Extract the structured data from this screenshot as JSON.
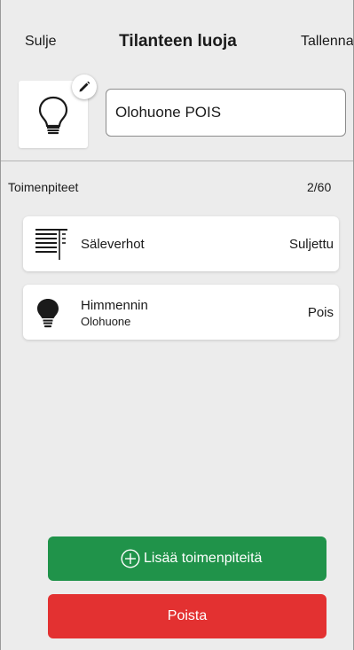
{
  "header": {
    "close_label": "Sulje",
    "title": "Tilanteen luoja",
    "save_label": "Tallenna"
  },
  "scene": {
    "icon": "lightbulb-icon",
    "name_value": "Olohuone POIS"
  },
  "actions_section": {
    "title": "Toimenpiteet",
    "count": "2/60",
    "items": [
      {
        "icon": "blinds-icon",
        "label": "Säleverhot",
        "sublabel": "",
        "status": "Suljettu"
      },
      {
        "icon": "dimmer-bulb-icon",
        "label": "Himmennin",
        "sublabel": "Olohuone",
        "status": "Pois"
      }
    ]
  },
  "buttons": {
    "add_label": "Lisää toimenpiteitä",
    "delete_label": "Poista"
  },
  "colors": {
    "add_button": "#20934a",
    "delete_button": "#e33131",
    "background": "#ececec"
  }
}
